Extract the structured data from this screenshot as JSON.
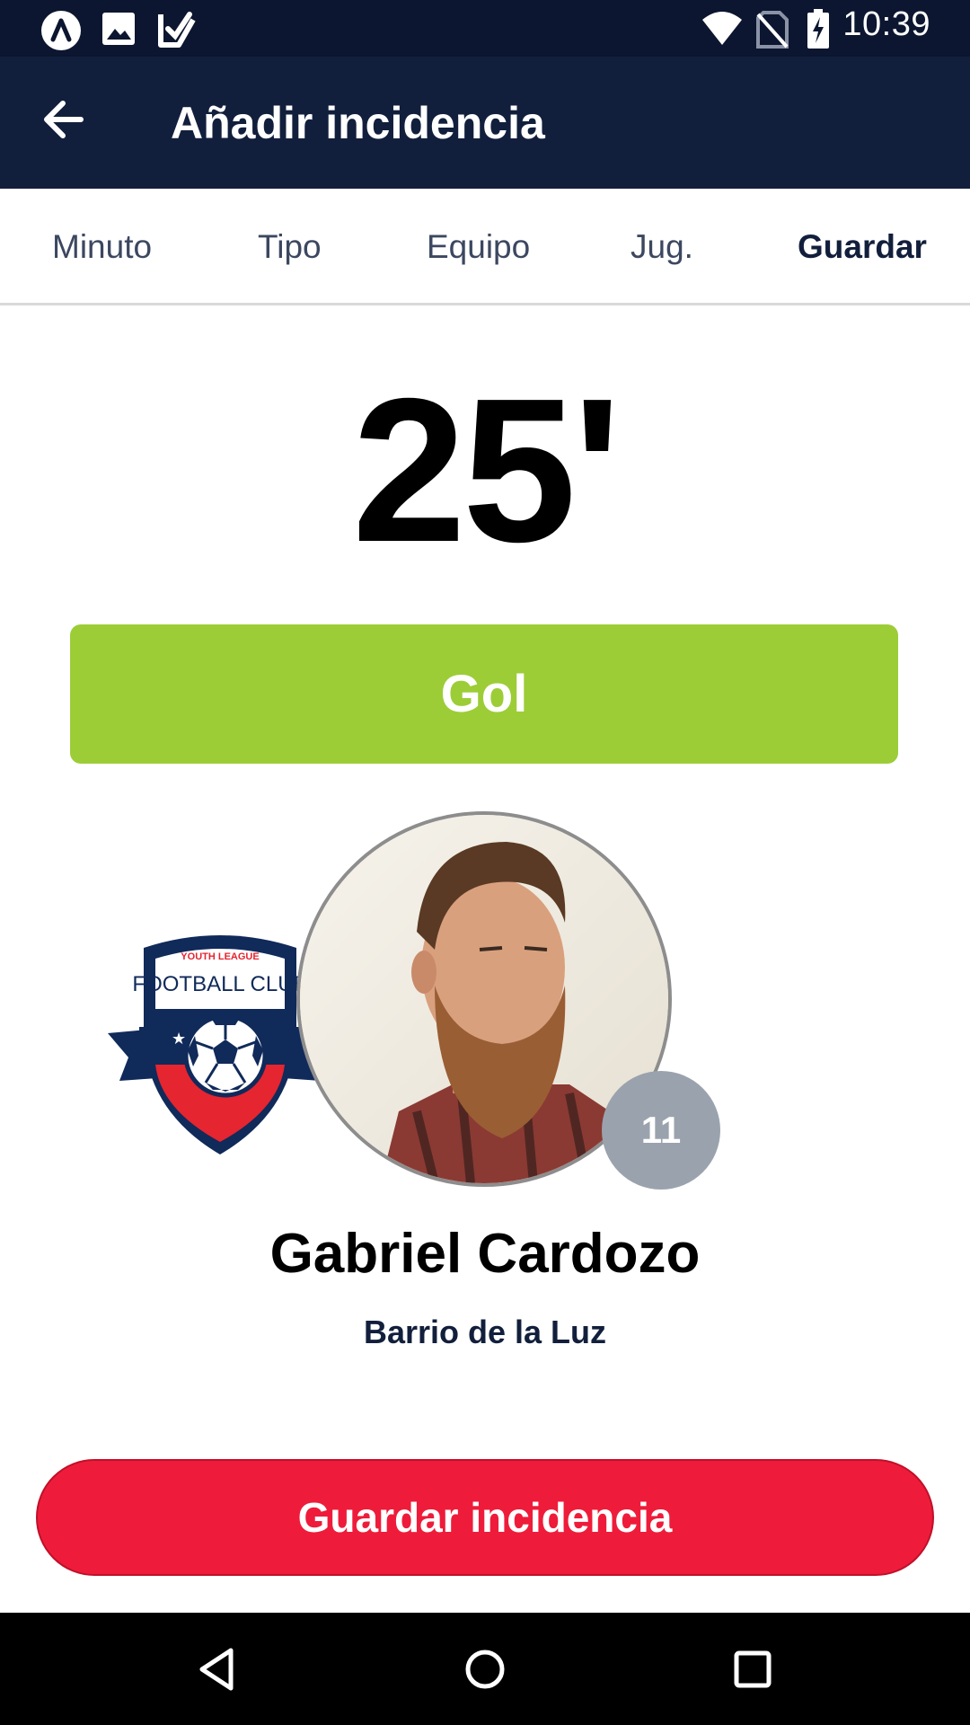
{
  "status_bar": {
    "time": "10:39",
    "left_icons": [
      "launcher-icon",
      "image-icon",
      "check-shield-icon"
    ],
    "right_icons": [
      "wifi-icon",
      "no-sim-icon",
      "battery-charging-icon"
    ]
  },
  "app_bar": {
    "title": "Añadir incidencia",
    "back_icon": "arrow-back-icon"
  },
  "steps": [
    {
      "label": "Minuto",
      "active": false
    },
    {
      "label": "Tipo",
      "active": false
    },
    {
      "label": "Equipo",
      "active": false
    },
    {
      "label": "Jug.",
      "active": false
    },
    {
      "label": "Guardar",
      "active": true
    }
  ],
  "incident": {
    "minute": "25'",
    "type_label": "Gol",
    "type_color": "#9ccd37"
  },
  "team": {
    "crest_text_top": "YOUTH LEAGUE",
    "crest_text_main": "FOOTBALL CLUB"
  },
  "player": {
    "number": "11",
    "name": "Gabriel Cardozo",
    "team_name": "Barrio de la Luz"
  },
  "actions": {
    "save_label": "Guardar incidencia",
    "save_color": "#ee1c3a"
  },
  "nav_bar": {
    "icons": [
      "nav-back-icon",
      "nav-home-icon",
      "nav-recents-icon"
    ]
  },
  "colors": {
    "primary_dark": "#121f3c",
    "status_bar": "#0c1630"
  }
}
